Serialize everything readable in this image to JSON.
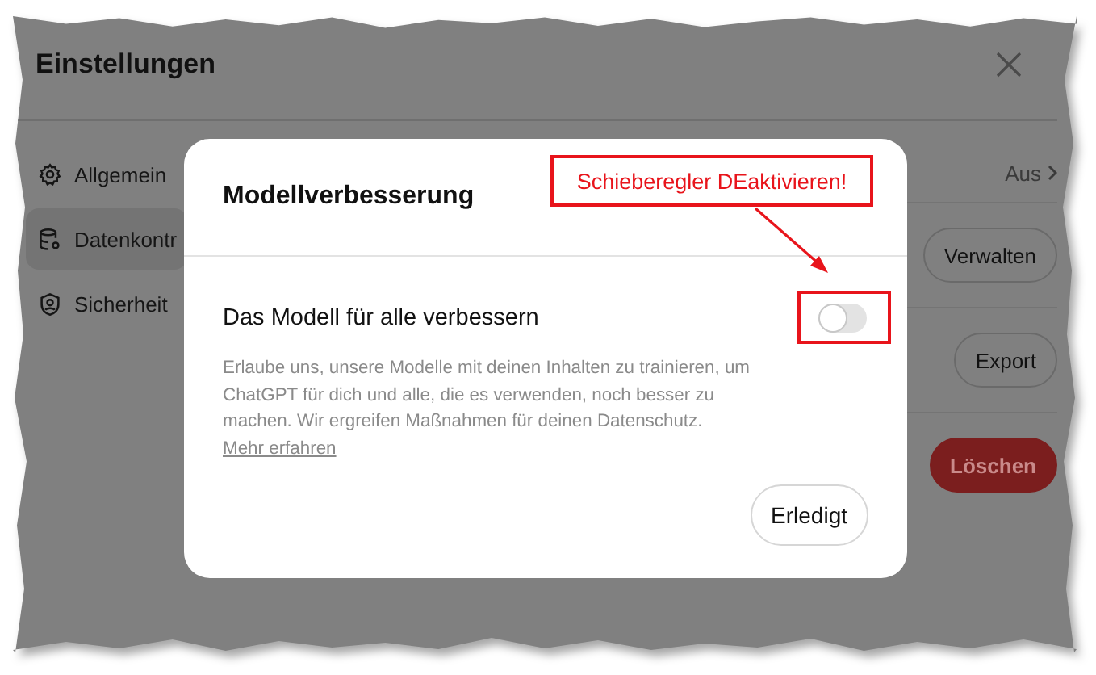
{
  "settings": {
    "title": "Einstellungen",
    "sidebar": [
      {
        "label": "Allgemein",
        "kind": "gear",
        "selected": false
      },
      {
        "label": "Datenkontr",
        "kind": "database",
        "selected": true
      },
      {
        "label": "Sicherheit",
        "kind": "shield",
        "selected": false
      }
    ],
    "rows": [
      {
        "kind": "value",
        "value": "Aus"
      },
      {
        "kind": "button",
        "button": "Verwalten"
      },
      {
        "kind": "button",
        "button": "Export"
      },
      {
        "kind": "danger",
        "button": "Löschen"
      }
    ]
  },
  "modal": {
    "title": "Modellverbesserung",
    "setting": {
      "label": "Das Modell für alle verbessern",
      "on": false
    },
    "description": "Erlaube uns, unsere Modelle mit deinen Inhalten zu trainieren, um ChatGPT für dich und alle, die es verwenden, noch besser zu machen. Wir ergreifen Maßnahmen für deinen Datenschutz.",
    "link": "Mehr erfahren",
    "button": "Erledigt"
  },
  "annotation": {
    "text": "Schieberegler DEaktivieren!"
  }
}
